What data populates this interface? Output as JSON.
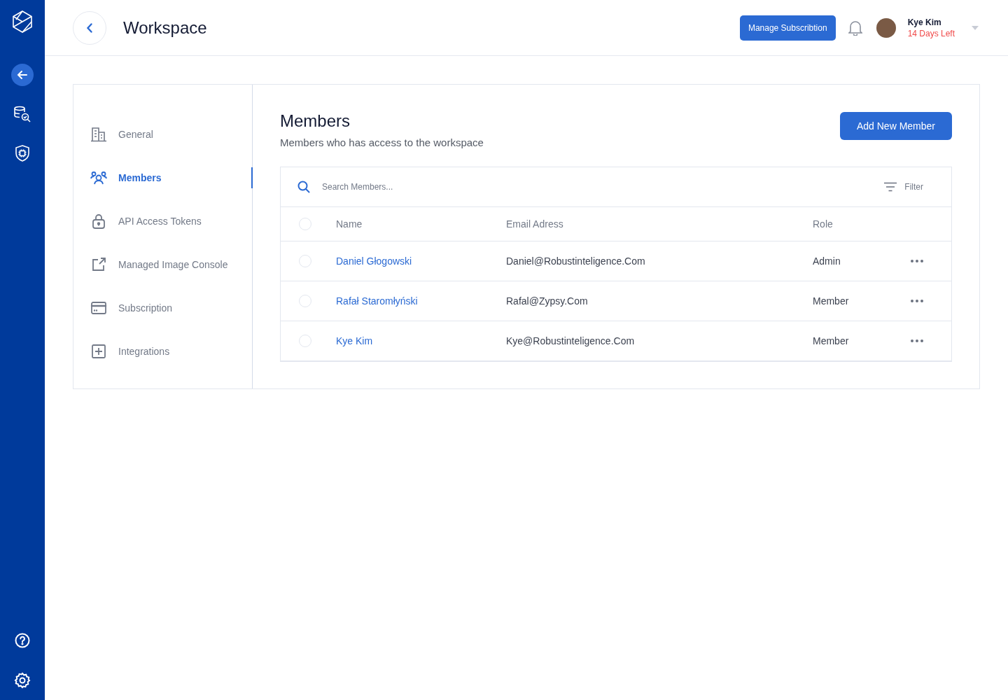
{
  "rail": {
    "items": [
      {
        "selected": true
      },
      {
        "selected": false
      },
      {
        "selected": false
      }
    ]
  },
  "header": {
    "title": "Workspace",
    "manage_button": "Manage Subscribtion",
    "user": {
      "name": "Kye Kim",
      "status": "14 Days Left"
    }
  },
  "nav": {
    "items": [
      {
        "label": "General",
        "selected": false
      },
      {
        "label": "Members",
        "selected": true
      },
      {
        "label": "API Access Tokens",
        "selected": false
      },
      {
        "label": "Managed Image Console",
        "selected": false
      },
      {
        "label": "Subscription",
        "selected": false
      },
      {
        "label": "Integrations",
        "selected": false
      }
    ]
  },
  "members": {
    "title": "Members",
    "subtitle": "Members who has access to the workspace",
    "add_button": "Add New Member",
    "search": {
      "placeholder": "Search Members..."
    },
    "filter": "Filter",
    "table": {
      "columns": [
        "Name",
        "Email Adress",
        "Role"
      ],
      "header_checked": false,
      "rows": [
        {
          "name": "Daniel Głogowski",
          "email": "Daniel@Robustinteligence.Com",
          "role": "Admin",
          "checked": false
        },
        {
          "name": "Rafał Staromłyński",
          "email": "Rafal@Zypsy.Com",
          "role": "Member",
          "checked": false
        },
        {
          "name": "Kye Kim",
          "email": "Kye@Robustinteligence.Com",
          "role": "Member",
          "checked": false
        }
      ]
    }
  }
}
